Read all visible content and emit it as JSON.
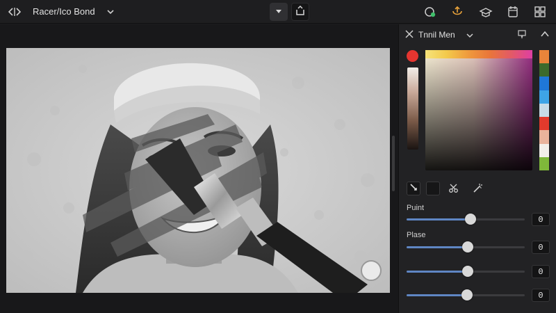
{
  "window": {
    "title": "Racer/Ico Bond"
  },
  "topbar": {
    "icons": [
      "back-forward-icon",
      "chevron-down-icon",
      "dropdown-icon",
      "share-icon",
      "layers-sync-icon",
      "export-icon",
      "hat-icon",
      "history-icon",
      "grid-icon"
    ]
  },
  "panel": {
    "title": "Tnnil Men",
    "colors": {
      "primary_swatch": "#e53530",
      "slider_accent": "#5f86c4",
      "palette": [
        "#e9843a",
        "#3c6a2c",
        "#1f77d8",
        "#3ea4e6",
        "#c8dbe6",
        "#e23a2c",
        "#e9b39b",
        "#f2efe9",
        "#7fb83a"
      ]
    },
    "sections": [
      {
        "label": "Puint"
      },
      {
        "label": "Plase"
      }
    ],
    "sliders": [
      {
        "value": 0.54,
        "display": "0"
      },
      {
        "value": 0.52,
        "display": "0"
      },
      {
        "value": 0.52,
        "display": "0"
      },
      {
        "value": 0.51,
        "display": "0"
      }
    ]
  }
}
